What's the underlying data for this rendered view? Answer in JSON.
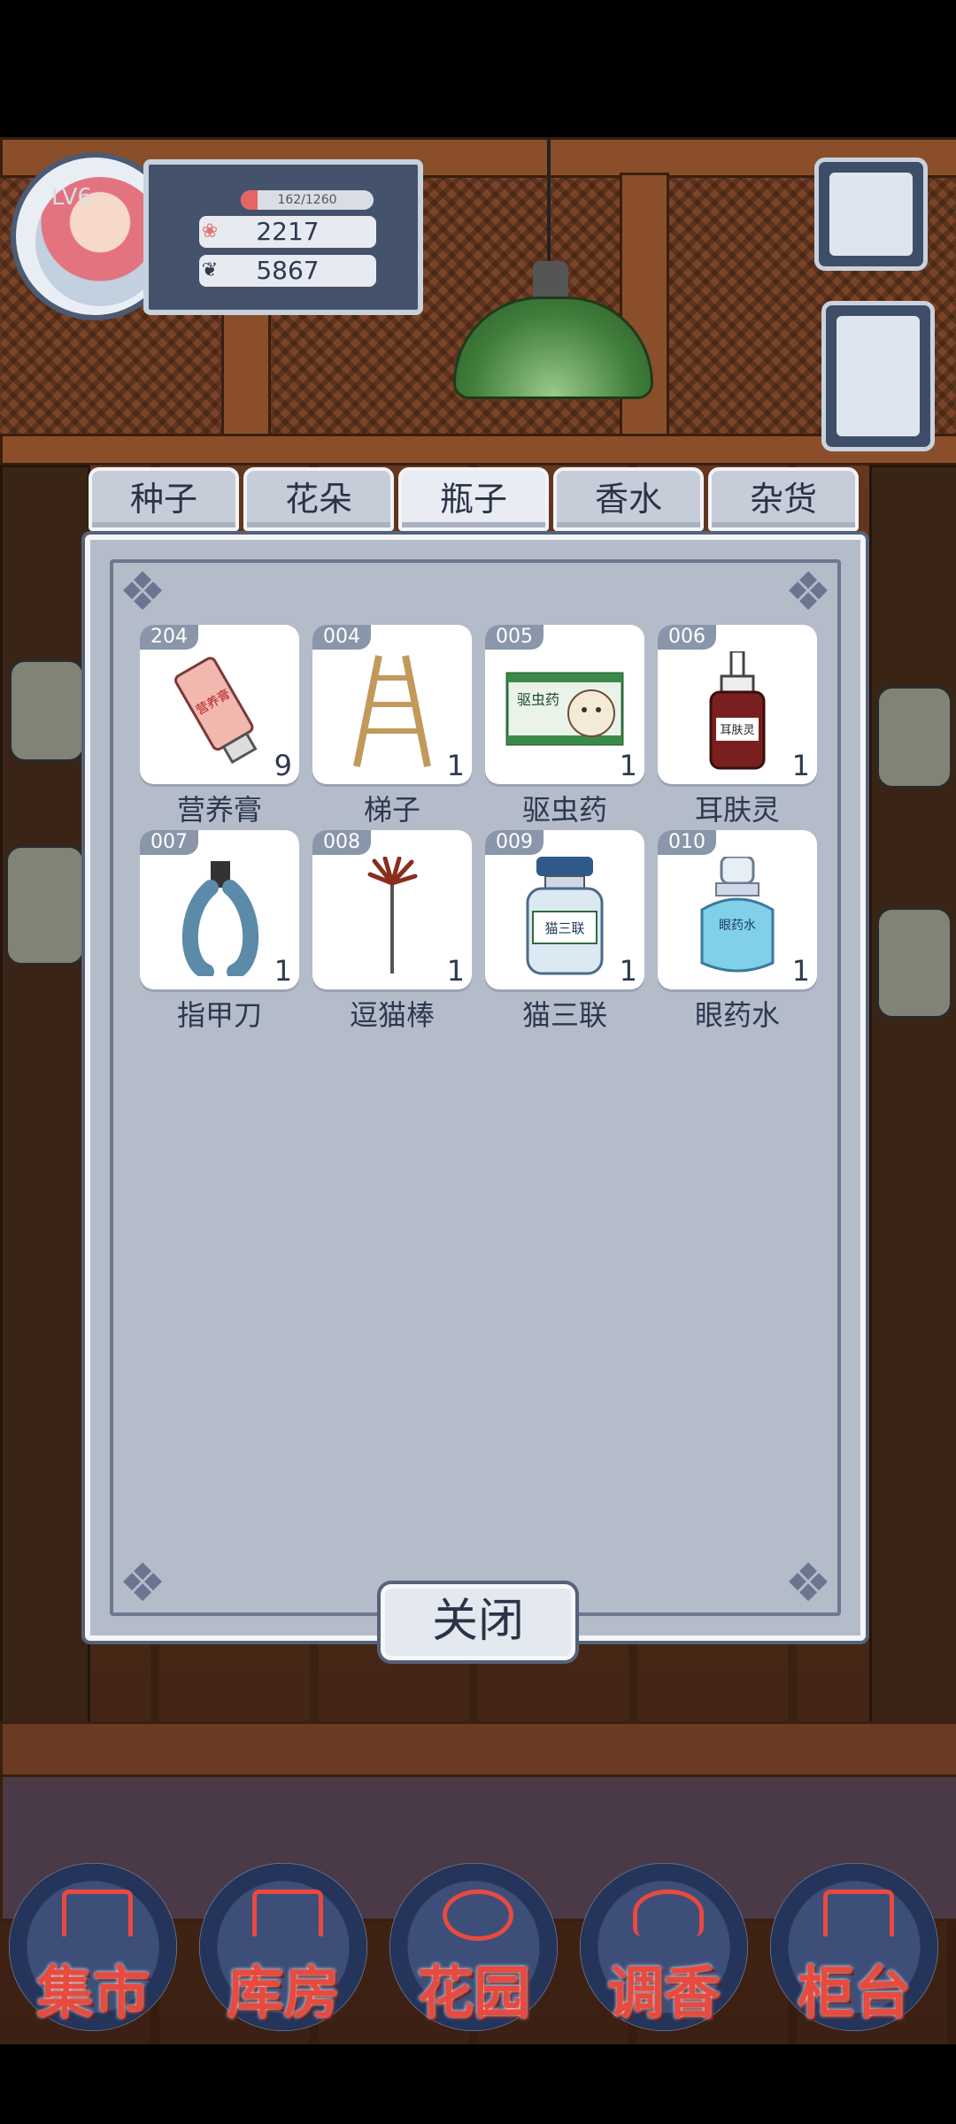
{
  "profile": {
    "level": "LV6",
    "exp_text": "162/1260",
    "exp_fraction": 0.129,
    "currency_1": "2217",
    "currency_2": "5867"
  },
  "tabs": [
    {
      "label": "种子",
      "active": false
    },
    {
      "label": "花朵",
      "active": false
    },
    {
      "label": "瓶子",
      "active": true
    },
    {
      "label": "香水",
      "active": false
    },
    {
      "label": "杂货",
      "active": false
    }
  ],
  "items": [
    {
      "id": "204",
      "name": "营养膏",
      "count": "9",
      "icon": "ointment-tube-icon",
      "art_text": "营养膏"
    },
    {
      "id": "004",
      "name": "梯子",
      "count": "1",
      "icon": "ladder-icon",
      "art_text": ""
    },
    {
      "id": "005",
      "name": "驱虫药",
      "count": "1",
      "icon": "dewormer-box-icon",
      "art_text": "驱虫药"
    },
    {
      "id": "006",
      "name": "耳肤灵",
      "count": "1",
      "icon": "ear-drop-bottle-icon",
      "art_text": "耳肤灵"
    },
    {
      "id": "007",
      "name": "指甲刀",
      "count": "1",
      "icon": "nail-clipper-icon",
      "art_text": ""
    },
    {
      "id": "008",
      "name": "逗猫棒",
      "count": "1",
      "icon": "cat-teaser-icon",
      "art_text": ""
    },
    {
      "id": "009",
      "name": "猫三联",
      "count": "1",
      "icon": "vaccine-vial-icon",
      "art_text": "猫三联"
    },
    {
      "id": "010",
      "name": "眼药水",
      "count": "1",
      "icon": "eye-drops-icon",
      "art_text": "眼药水"
    }
  ],
  "close_label": "关闭",
  "bottom_nav": [
    {
      "label": "集市"
    },
    {
      "label": "库房"
    },
    {
      "label": "花园"
    },
    {
      "label": "调香"
    },
    {
      "label": "柜台"
    }
  ],
  "colors": {
    "accent_red": "#e84a3f",
    "panel_bg": "#b4bcc9",
    "frame_navy": "#44536b"
  }
}
